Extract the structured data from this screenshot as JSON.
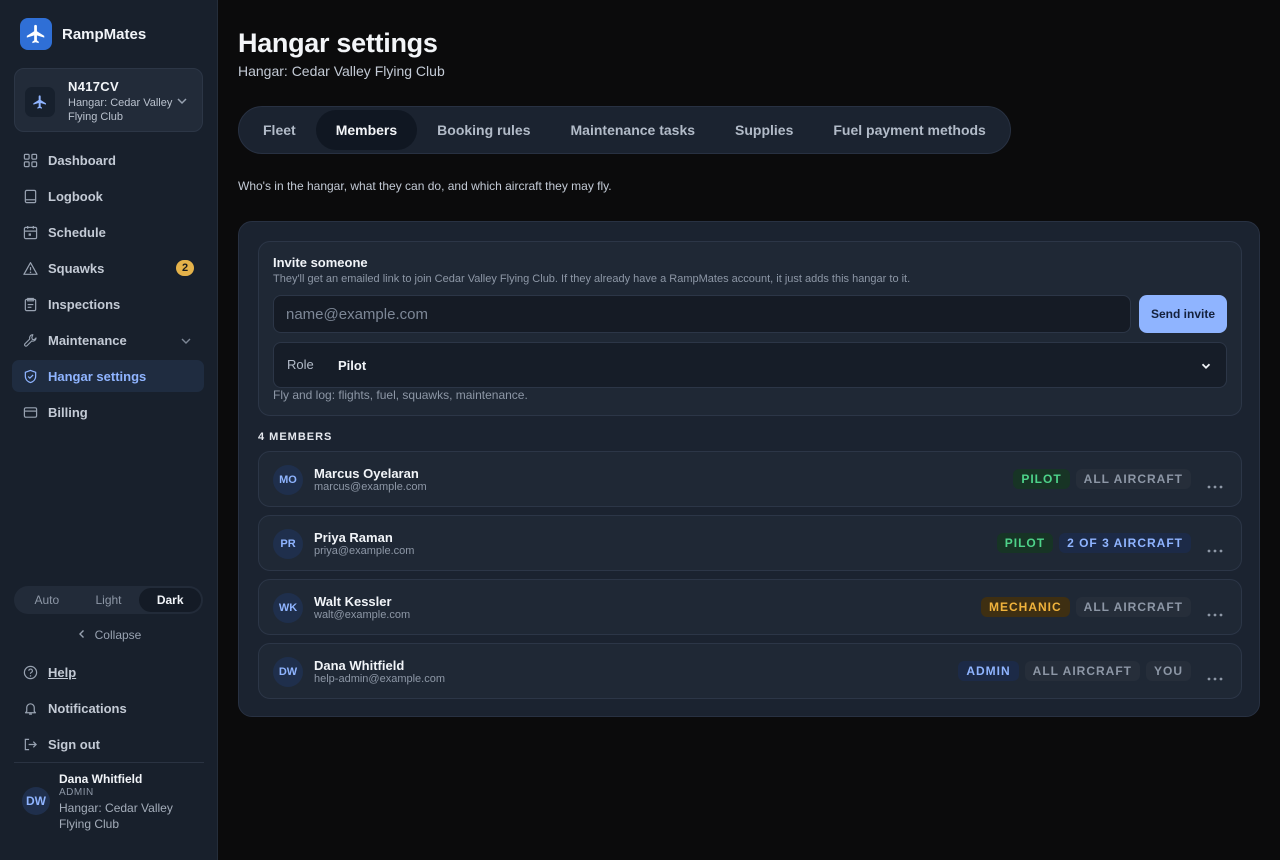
{
  "brand": {
    "name": "RampMates"
  },
  "aircraft": {
    "tail": "N417CV",
    "hangar": "Hangar: Cedar Valley Flying Club"
  },
  "nav": {
    "items": [
      {
        "label": "Dashboard"
      },
      {
        "label": "Logbook"
      },
      {
        "label": "Schedule"
      },
      {
        "label": "Squawks",
        "badge": "2"
      },
      {
        "label": "Inspections"
      },
      {
        "label": "Maintenance"
      },
      {
        "label": "Hangar settings"
      },
      {
        "label": "Billing"
      }
    ]
  },
  "theme": {
    "options": [
      "Auto",
      "Light",
      "Dark"
    ],
    "selected": "Dark"
  },
  "collapse_label": "Collapse",
  "footer_nav": {
    "help": "Help",
    "notifications": "Notifications",
    "sign_out": "Sign out"
  },
  "user": {
    "initials": "DW",
    "name": "Dana Whitfield",
    "role": "ADMIN",
    "hangar": "Hangar: Cedar Valley Flying Club"
  },
  "page": {
    "title": "Hangar settings",
    "subtitle": "Hangar: Cedar Valley Flying Club",
    "tabs": [
      "Fleet",
      "Members",
      "Booking rules",
      "Maintenance tasks",
      "Supplies",
      "Fuel payment methods"
    ],
    "selected_tab": "Members",
    "description": "Who's in the hangar, what they can do, and which aircraft they may fly."
  },
  "invite": {
    "title": "Invite someone",
    "help": "They'll get an emailed link to join Cedar Valley Flying Club. If they already have a RampMates account, it just adds this hangar to it.",
    "email_placeholder": "name@example.com",
    "email_value": "",
    "send_label": "Send invite",
    "role_label": "Role",
    "role_value": "Pilot",
    "role_hint": "Fly and log: flights, fuel, squawks, maintenance."
  },
  "members": {
    "count_label": "4 MEMBERS",
    "list": [
      {
        "initials": "MO",
        "name": "Marcus Oyelaran",
        "email": "marcus@example.com",
        "role": "PILOT",
        "access": "ALL AIRCRAFT"
      },
      {
        "initials": "PR",
        "name": "Priya Raman",
        "email": "priya@example.com",
        "role": "PILOT",
        "access": "2 OF 3 AIRCRAFT"
      },
      {
        "initials": "WK",
        "name": "Walt Kessler",
        "email": "walt@example.com",
        "role": "MECHANIC",
        "access": "ALL AIRCRAFT"
      },
      {
        "initials": "DW",
        "name": "Dana Whitfield",
        "email": "help-admin@example.com",
        "role": "ADMIN",
        "access": "ALL AIRCRAFT",
        "you": "YOU"
      }
    ]
  },
  "colors": {
    "accent": "#8fb4ff",
    "pilot": "#4ed38a",
    "mechanic": "#f0b33c",
    "badge_warning": "#e4b24a"
  }
}
